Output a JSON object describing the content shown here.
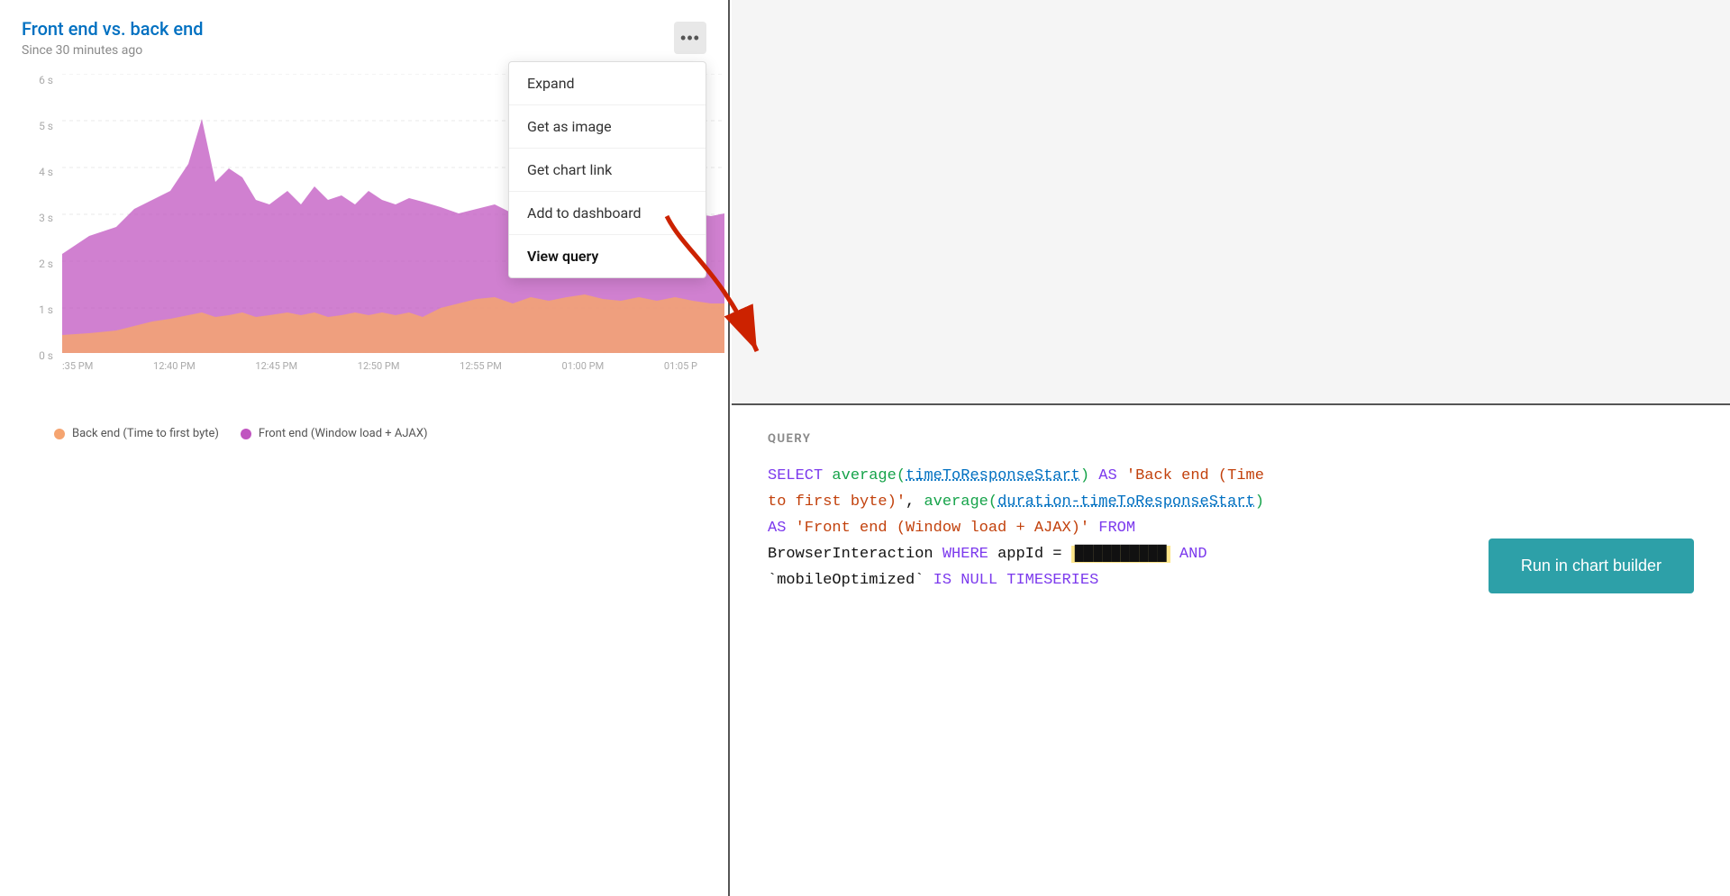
{
  "chart": {
    "title": "Front end vs. back end",
    "subtitle": "Since 30 minutes ago",
    "menu_btn_label": "...",
    "y_labels": [
      "6 s",
      "5 s",
      "4 s",
      "3 s",
      "2 s",
      "1 s",
      "0 s"
    ],
    "x_labels": [
      ":35 PM",
      "12:40 PM",
      "12:45 PM",
      "12:50 PM",
      "12:55 PM",
      "01:00 PM",
      "01:05 P"
    ],
    "legend": [
      {
        "id": "back-end",
        "color": "orange",
        "label": "Back end (Time to first byte)"
      },
      {
        "id": "front-end",
        "color": "purple",
        "label": "Front end (Window load + AJAX)"
      }
    ]
  },
  "dropdown": {
    "items": [
      {
        "id": "expand",
        "label": "Expand"
      },
      {
        "id": "get-as-image",
        "label": "Get as image"
      },
      {
        "id": "get-chart-link",
        "label": "Get chart link"
      },
      {
        "id": "add-to-dashboard",
        "label": "Add to dashboard"
      },
      {
        "id": "view-query",
        "label": "View query",
        "active": true
      }
    ]
  },
  "query": {
    "section_label": "QUERY",
    "lines": [
      "SELECT average(timeToResponseStart) AS 'Back end (Time",
      "to first byte)', average(duration-timeToResponseStart)",
      "AS 'Front end (Window load + AJAX)' FROM",
      "BrowserInteraction WHERE appId = ██████████ AND",
      "`mobileOptimized` IS NULL TIMESERIES"
    ],
    "run_btn_label": "Run in chart builder"
  }
}
